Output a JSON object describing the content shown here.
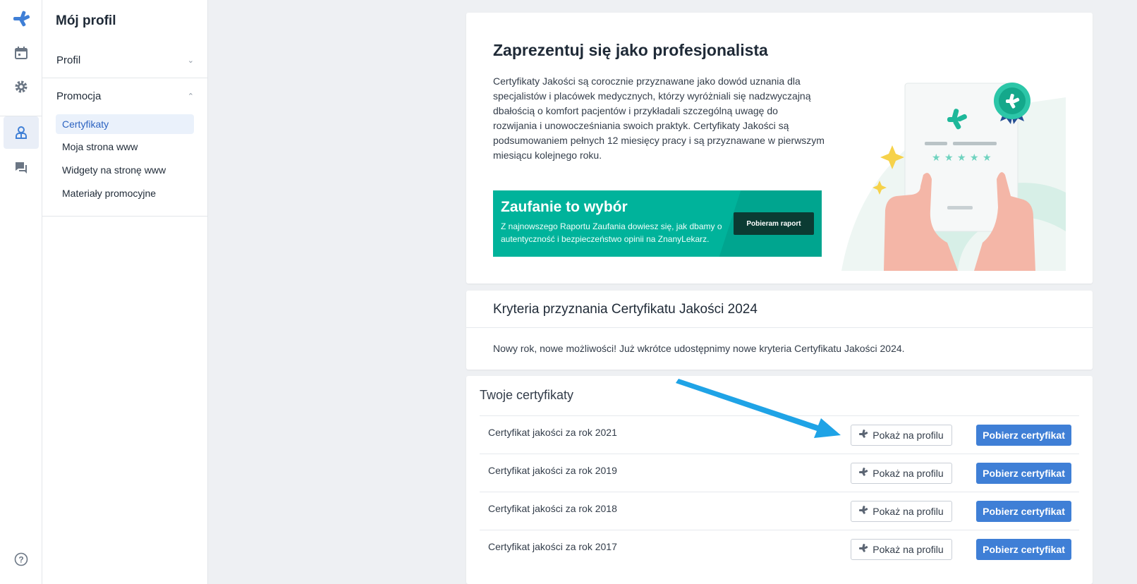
{
  "rail": {
    "items": [
      {
        "name": "logo-icon"
      },
      {
        "name": "calendar-icon"
      },
      {
        "name": "gear-icon"
      },
      {
        "name": "doctor-profile-icon"
      },
      {
        "name": "chat-icon"
      },
      {
        "name": "help-icon"
      }
    ]
  },
  "sidebar": {
    "title": "Mój profil",
    "sections": [
      {
        "label": "Profil",
        "chevron": "chevron-down"
      },
      {
        "label": "Promocja",
        "chevron": "chevron-up"
      }
    ],
    "items": [
      {
        "label": "Certyfikaty",
        "active": true
      },
      {
        "label": "Moja strona www"
      },
      {
        "label": "Widgety na stronę www"
      },
      {
        "label": "Materiały promocyjne"
      }
    ]
  },
  "hero": {
    "title": "Zaprezentuj się jako profesjonalista",
    "text": "Certyfikaty Jakości są corocznie przyznawane jako dowód uznania dla specjalistów i placówek medycznych, którzy wyróżniali się nadzwyczajną dbałością o komfort pacjentów i przykładali szczególną uwagę do rozwijania i unowocześniania swoich praktyk. Certyfikaty Jakości są podsumowaniem pełnych 12 miesięcy pracy i są przyznawane w pierwszym miesiącu kolejnego roku.",
    "banner": {
      "title": "Zaufanie to wybór",
      "text": "Z najnowszego Raportu Zaufania dowiesz się, jak dbamy o autentyczność i bezpieczeństwo opinii na ZnanyLekarz.",
      "button": "Pobieram raport"
    }
  },
  "criteria": {
    "title": "Kryteria przyznania Certyfikatu Jakości 2024",
    "text": "Nowy rok, nowe możliwości! Już wkrótce udostępnimy nowe kryteria Certyfikatu Jakości 2024."
  },
  "certificates": {
    "title": "Twoje certyfikaty",
    "show_label": "Pokaż na profilu",
    "download_label": "Pobierz certyfikat",
    "rows": [
      {
        "label": "Certyfikat jakości za rok 2021"
      },
      {
        "label": "Certyfikat jakości za rok 2019"
      },
      {
        "label": "Certyfikat jakości za rok 2018"
      },
      {
        "label": "Certyfikat jakości za rok 2017"
      }
    ]
  },
  "colors": {
    "brand_teal": "#00b39b",
    "primary_blue": "#3f7fd6",
    "annotation_arrow": "#1fa3e6"
  }
}
